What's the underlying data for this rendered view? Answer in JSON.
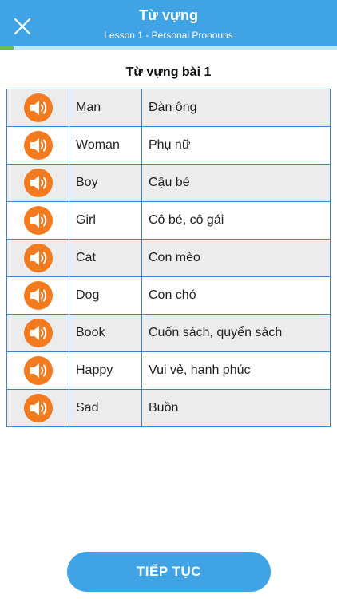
{
  "header": {
    "title": "Từ vựng",
    "subtitle": "Lesson 1 - Personal Pronouns",
    "close_icon": "close-icon",
    "progress": 0.04
  },
  "section_title": "Từ vựng bài 1",
  "vocabulary": [
    {
      "word": "Man",
      "meaning": "Đàn ông"
    },
    {
      "word": "Woman",
      "meaning": "Phụ nữ"
    },
    {
      "word": "Boy",
      "meaning": "Cậu bé"
    },
    {
      "word": "Girl",
      "meaning": "Cô bé, cô gái"
    },
    {
      "word": "Cat",
      "meaning": "Con mèo"
    },
    {
      "word": "Dog",
      "meaning": "Con chó"
    },
    {
      "word": "Book",
      "meaning": "Cuốn sách, quyển sách"
    },
    {
      "word": "Happy",
      "meaning": "Vui vẻ, hạnh phúc"
    },
    {
      "word": "Sad",
      "meaning": "Buồn"
    }
  ],
  "audio_icon": "speaker-icon",
  "continue_label": "TIẾP TỤC",
  "colors": {
    "header": "#3fa3e6",
    "progress": "#6cc04a",
    "speaker": "#f47a20",
    "table_border": "#3a84c8",
    "row_shade": "#ececec"
  }
}
